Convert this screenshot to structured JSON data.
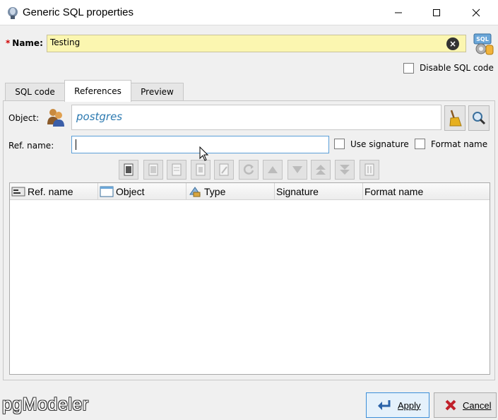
{
  "window": {
    "title": "Generic SQL properties"
  },
  "name_field": {
    "label": "Name:",
    "required_mark": "*",
    "value": "Testing"
  },
  "disable_sql": {
    "label": "Disable SQL code",
    "checked": false
  },
  "tabs": [
    {
      "label": "SQL code",
      "active": false
    },
    {
      "label": "References",
      "active": true
    },
    {
      "label": "Preview",
      "active": false
    }
  ],
  "object": {
    "label": "Object:",
    "value": "postgres"
  },
  "ref_name": {
    "label": "Ref. name:",
    "value": ""
  },
  "use_signature": {
    "label": "Use signature",
    "checked": false
  },
  "format_name": {
    "label": "Format name",
    "checked": false
  },
  "table": {
    "columns": [
      "Ref. name",
      "Object",
      "Type",
      "Signature",
      "Format name"
    ],
    "rows": []
  },
  "footer": {
    "logo": "pgModeler",
    "apply_label": "Apply",
    "cancel_label": "Cancel"
  },
  "colors": {
    "name_bg": "#fbf6b0",
    "object_text": "#2b79b0",
    "focus_border": "#5b9fd8"
  }
}
